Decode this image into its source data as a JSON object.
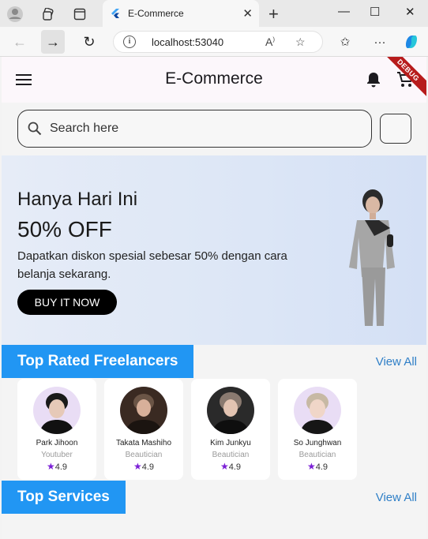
{
  "browser": {
    "tab_title": "E-Commerce",
    "address": "localhost:53040"
  },
  "app": {
    "title": "E-Commerce",
    "debug_label": "DEBUG",
    "search_placeholder": "Search here",
    "banner": {
      "title": "Hanya Hari Ini",
      "discount": "50% OFF",
      "description": "Dapatkan diskon spesial sebesar 50% dengan cara belanja sekarang.",
      "button_label": "BUY IT NOW"
    },
    "top_rated": {
      "heading": "Top Rated Freelancers",
      "view_all": "View All",
      "freelancers": [
        {
          "name": "Park Jihoon",
          "role": "Youtuber",
          "rating": "4.9"
        },
        {
          "name": "Takata Mashiho",
          "role": "Beautician",
          "rating": "4.9"
        },
        {
          "name": "Kim Junkyu",
          "role": "Beautician",
          "rating": "4.9"
        },
        {
          "name": "So Junghwan",
          "role": "Beautician",
          "rating": "4.9"
        }
      ]
    },
    "top_services": {
      "heading": "Top Services",
      "view_all": "View All"
    }
  },
  "colors": {
    "section_blue": "#2196f3",
    "star_purple": "#7b1fd6",
    "link_blue": "#2f7fc7"
  }
}
